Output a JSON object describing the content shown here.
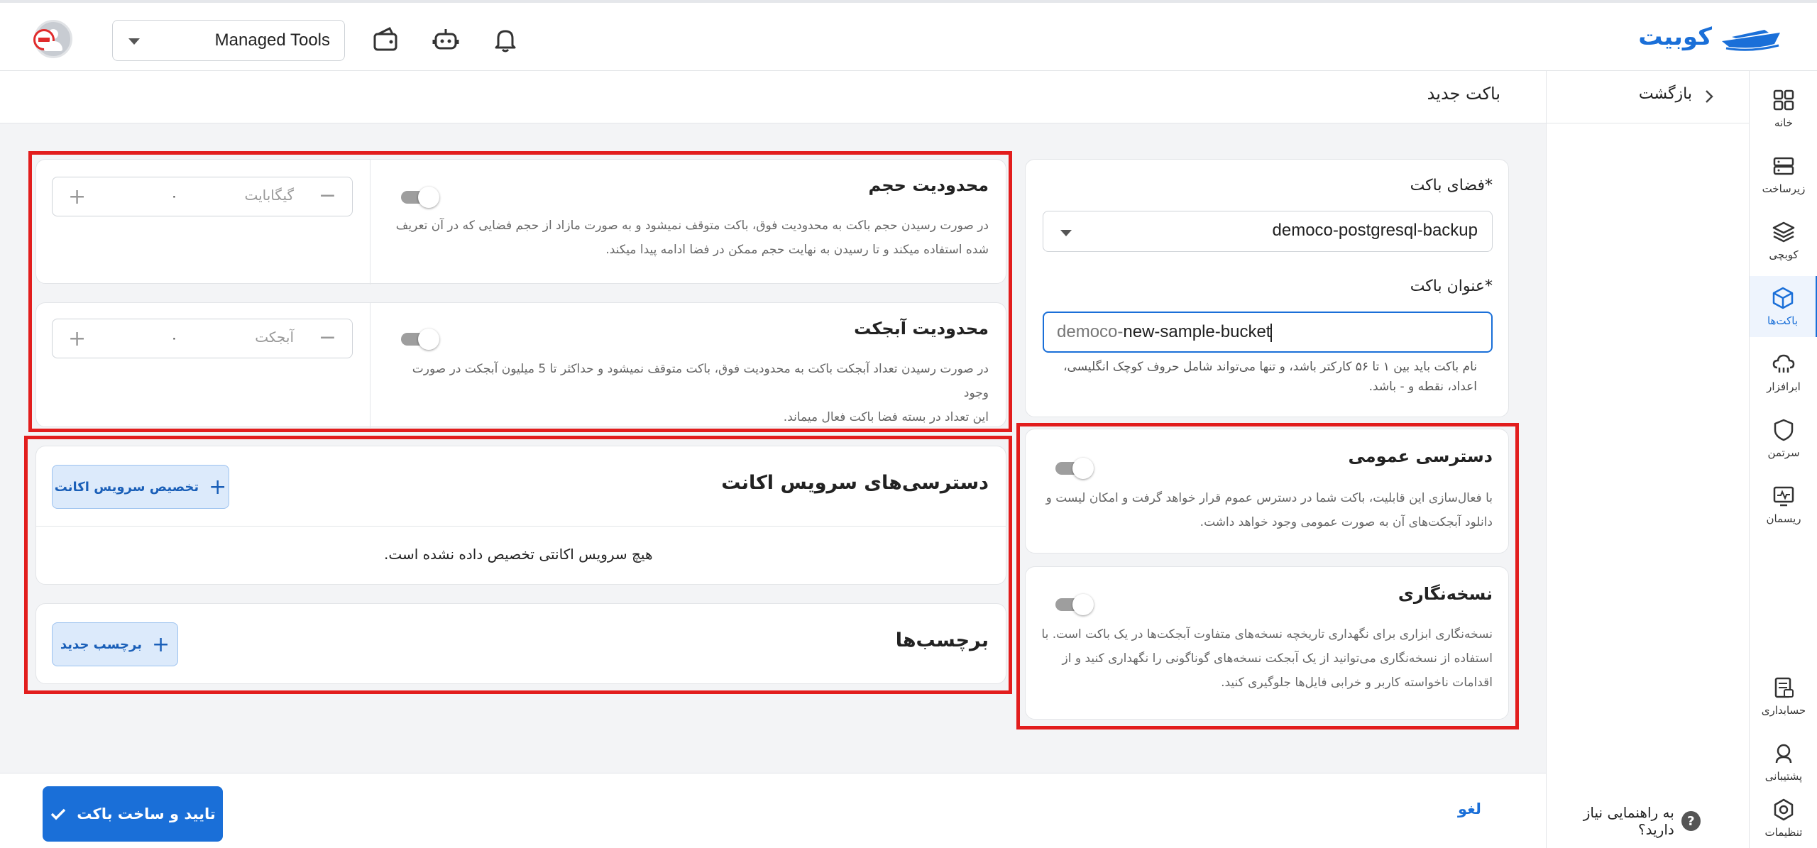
{
  "header": {
    "brand": "کوبیت",
    "org_select": "Managed Tools"
  },
  "sidebar": {
    "items": [
      {
        "label": "خانه",
        "icon": "grid-icon"
      },
      {
        "label": "زیرساخت",
        "icon": "server-icon"
      },
      {
        "label": "کوبچی",
        "icon": "layers-icon"
      },
      {
        "label": "باکت‌ها",
        "icon": "cube-icon",
        "active": true
      },
      {
        "label": "ابرافزار",
        "icon": "cloud-app-icon"
      },
      {
        "label": "سرتمن",
        "icon": "shield-icon"
      },
      {
        "label": "ریسمان",
        "icon": "monitor-pulse-icon"
      },
      {
        "label": "حسابداری",
        "icon": "receipt-icon"
      },
      {
        "label": "پشتیبانی",
        "icon": "headset-icon"
      },
      {
        "label": "تنظیمات",
        "icon": "settings-icon"
      }
    ]
  },
  "nav": {
    "back_label": "بازگشت",
    "page_title": "باکت جدید",
    "help_text": "به راهنمایی نیاز دارید؟"
  },
  "form": {
    "space_label": "فضای باکت*",
    "space_value": "democo-postgresql-backup",
    "title_label": "عنوان باکت*",
    "title_prefix": "democo-",
    "title_value": "new-sample-bucket",
    "title_help_1": "نام باکت باید بین ۱ تا ۵۶ کارکتر باشد، و تنها می‌تواند شامل حروف کوچک انگلیسی،",
    "title_help_2": "اعداد، نقطه و - باشد."
  },
  "public_access": {
    "title": "دسترسی عمومی",
    "desc_1": "با فعال‌سازی این قابلیت، باکت شما در دسترس عموم قرار خواهد گرفت و امکان لیست و",
    "desc_2": "دانلود آبجکت‌های آن به صورت عمومی وجود خواهد داشت.",
    "enabled": false
  },
  "versioning": {
    "title": "نسخه‌نگاری",
    "desc_1": "نسخه‌نگاری ابزاری برای نگهداری تاریخچه نسخه‌های متفاوت آبجکت‌ها در یک باکت است. با",
    "desc_2": "استفاده از نسخه‌نگاری می‌توانید از یک آبجکت نسخه‌های گوناگونی را نگهداری کنید و از",
    "desc_3": "اقدامات ناخواسته کاربر و خرابی فایل‌ها جلوگیری کنید.",
    "enabled": false
  },
  "size_limit": {
    "title": "محدودیت حجم",
    "desc_1": "در صورت رسیدن حجم باکت به محدودیت فوق، باکت متوقف نمیشود و به صورت مازاد از حجم فضایی که در آن تعریف",
    "desc_2": "شده استفاده میکند و تا رسیدن به نهایت حجم ممکن در فضا ادامه پیدا میکند.",
    "value": "۰",
    "unit": "گیگابایت",
    "enabled": false
  },
  "object_limit": {
    "title": "محدودیت آبجکت",
    "desc_1": "در صورت رسیدن تعداد آبجکت باکت به محدودیت فوق، باکت متوقف نمیشود و حداکثر تا 5 میلیون آبجکت در صورت وجود",
    "desc_2": "این تعداد در بسته فضا باکت فعال میماند.",
    "value": "۰",
    "unit": "آبجکت",
    "enabled": false
  },
  "service_accounts": {
    "title": "دسترسی‌های سرویس اکانت",
    "add_button": "تخصیص سرویس اکانت",
    "empty": "هیچ سرویس اکانتی تخصیص داده نشده است."
  },
  "tags": {
    "title": "برچسب‌ها",
    "add_button": "برچسب جدید"
  },
  "footer": {
    "submit": "تایید و ساخت باکت",
    "cancel": "لغو"
  },
  "colors": {
    "accent": "#1a6fd8",
    "highlight_box": "#e21d1d"
  }
}
